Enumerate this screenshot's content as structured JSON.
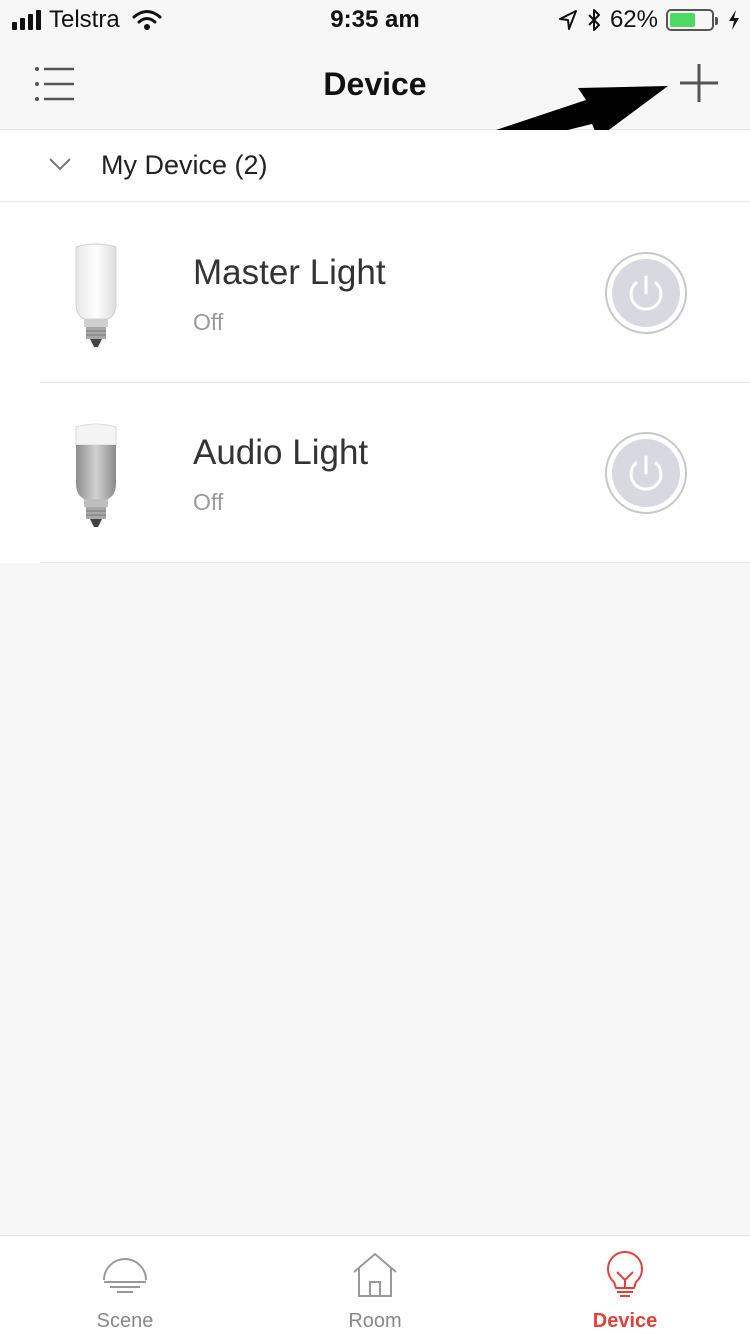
{
  "status_bar": {
    "carrier": "Telstra",
    "time": "9:35 am",
    "battery_percent": "62%",
    "battery_level": 0.62,
    "icons": [
      "signal-bars-icon",
      "wifi-icon",
      "location-arrow-icon",
      "bluetooth-icon",
      "battery-icon",
      "charging-bolt-icon"
    ]
  },
  "nav": {
    "title": "Device",
    "left_icon": "menu-list-icon",
    "right_icon": "plus-icon"
  },
  "section": {
    "title": "My Device (2)",
    "expanded": true
  },
  "devices": [
    {
      "name": "Master Light",
      "status": "Off",
      "icon": "white-bulb-icon"
    },
    {
      "name": "Audio Light",
      "status": "Off",
      "icon": "silver-bulb-icon"
    }
  ],
  "tabs": [
    {
      "label": "Scene",
      "icon": "scene-lamp-icon",
      "active": false
    },
    {
      "label": "Room",
      "icon": "house-icon",
      "active": false
    },
    {
      "label": "Device",
      "icon": "bulb-icon",
      "active": true
    }
  ],
  "colors": {
    "accent": "#e0413a",
    "background": "#f7f7f7",
    "battery_fill": "#4cd964",
    "power_button": "#d8d9e0"
  }
}
